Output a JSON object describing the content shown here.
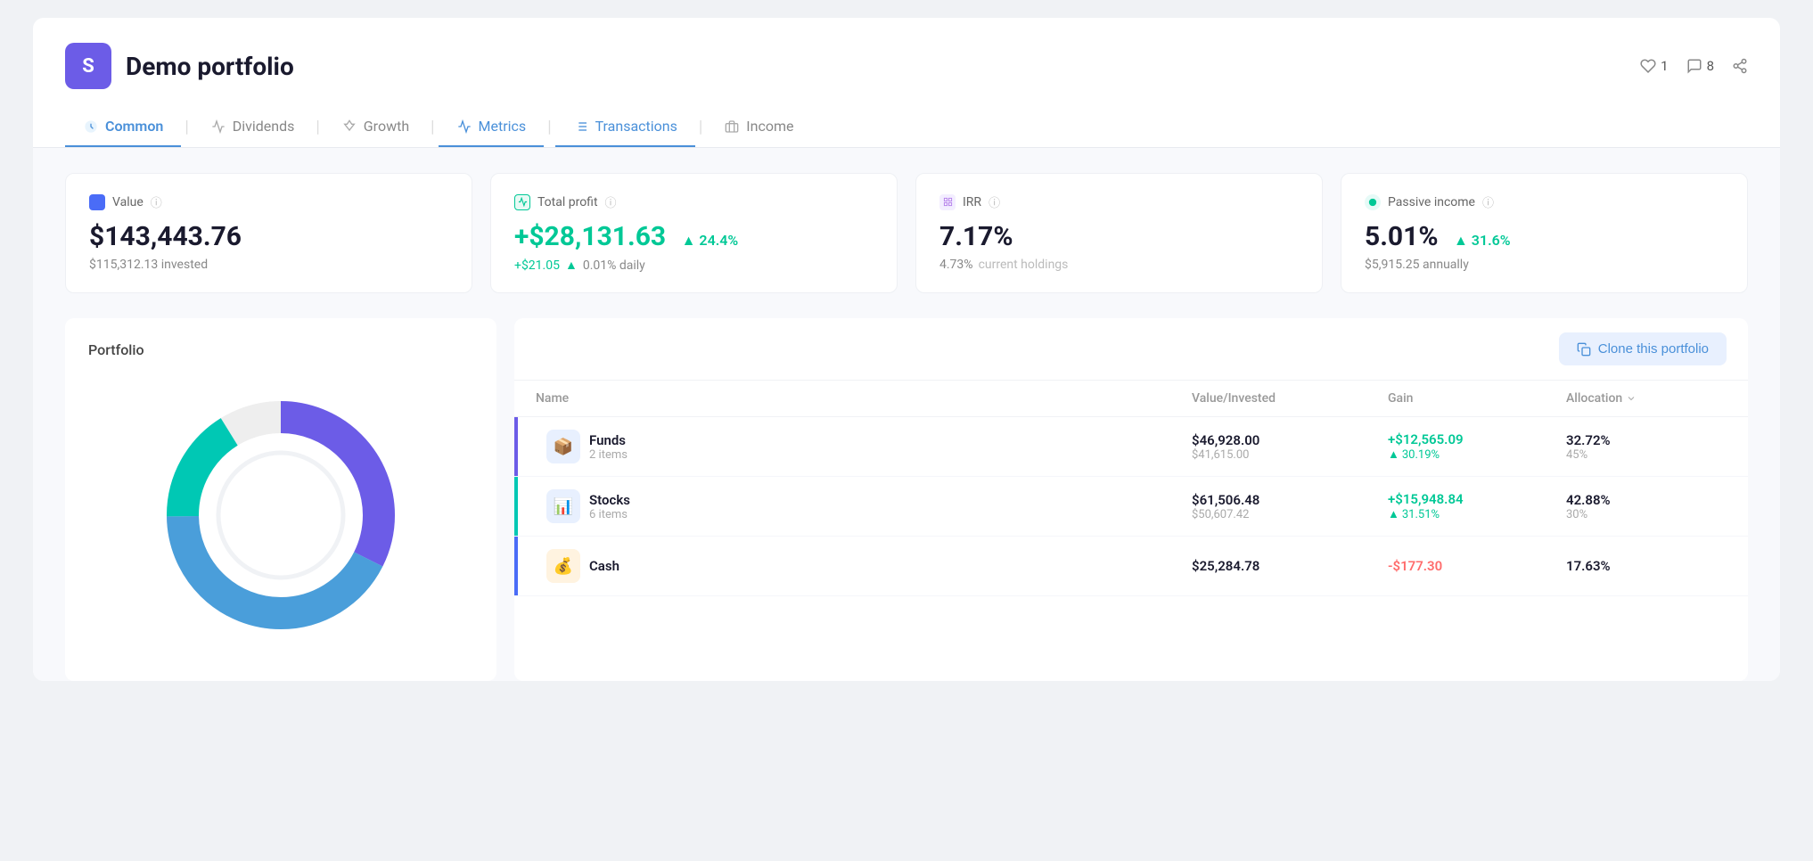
{
  "header": {
    "icon_letter": "S",
    "title": "Demo portfolio",
    "likes_count": "1",
    "comments_count": "8"
  },
  "tabs": [
    {
      "id": "common",
      "label": "Common",
      "active": true,
      "icon": "shield"
    },
    {
      "id": "dividends",
      "label": "Dividends",
      "active": false,
      "icon": "chart-bar"
    },
    {
      "id": "growth",
      "label": "Growth",
      "active": false,
      "icon": "rocket"
    },
    {
      "id": "metrics",
      "label": "Metrics",
      "active": true,
      "icon": "chart-line"
    },
    {
      "id": "transactions",
      "label": "Transactions",
      "active": true,
      "icon": "list"
    },
    {
      "id": "income",
      "label": "Income",
      "active": false,
      "icon": "dollar"
    }
  ],
  "stats": [
    {
      "id": "value",
      "label": "Value",
      "value": "$143,443.76",
      "sub1": "$115,312.13 invested",
      "sub2": "",
      "color": "blue"
    },
    {
      "id": "total-profit",
      "label": "Total profit",
      "value": "+$28,131.63",
      "badge": "24.4%",
      "sub1": "+$21.05",
      "sub2": "0.01% daily",
      "color": "green"
    },
    {
      "id": "irr",
      "label": "IRR",
      "value": "7.17%",
      "sub1": "4.73%",
      "sub2": "current holdings",
      "color": "purple"
    },
    {
      "id": "passive-income",
      "label": "Passive income",
      "value": "5.01%",
      "badge": "31.6%",
      "sub1": "$5,915.25 annually",
      "color": "teal"
    }
  ],
  "portfolio_section": {
    "title": "Portfolio"
  },
  "table": {
    "clone_button": "Clone this portfolio",
    "columns": [
      "Name",
      "Value/Invested",
      "Gain",
      "Allocation"
    ],
    "rows": [
      {
        "name": "Funds",
        "count": "2 items",
        "value": "$46,928.00",
        "invested": "$41,615.00",
        "gain": "+$12,565.09",
        "gain_pct": "30.19%",
        "alloc": "32.72%",
        "alloc_sub": "45%",
        "color": "#6c5ce7",
        "icon": "📦"
      },
      {
        "name": "Stocks",
        "count": "6 items",
        "value": "$61,506.48",
        "invested": "$50,607.42",
        "gain": "+$15,948.84",
        "gain_pct": "31.51%",
        "alloc": "42.88%",
        "alloc_sub": "30%",
        "color": "#00c8b4",
        "icon": "📊"
      },
      {
        "name": "Cash",
        "count": "",
        "value": "$25,284.78",
        "invested": "",
        "gain": "-$177.30",
        "gain_pct": "",
        "alloc": "17.63%",
        "alloc_sub": "",
        "color": "#4a6cf7",
        "icon": "💰"
      }
    ]
  },
  "chart": {
    "segments": [
      {
        "label": "Funds",
        "color": "#6c5ce7",
        "pct": 32.72,
        "startAngle": 0
      },
      {
        "label": "Stocks",
        "color": "#4a9eda",
        "pct": 42.88,
        "startAngle": 117.8
      },
      {
        "label": "Cash",
        "color": "#00c8b4",
        "pct": 17.63,
        "startAngle": 272.4
      }
    ]
  }
}
